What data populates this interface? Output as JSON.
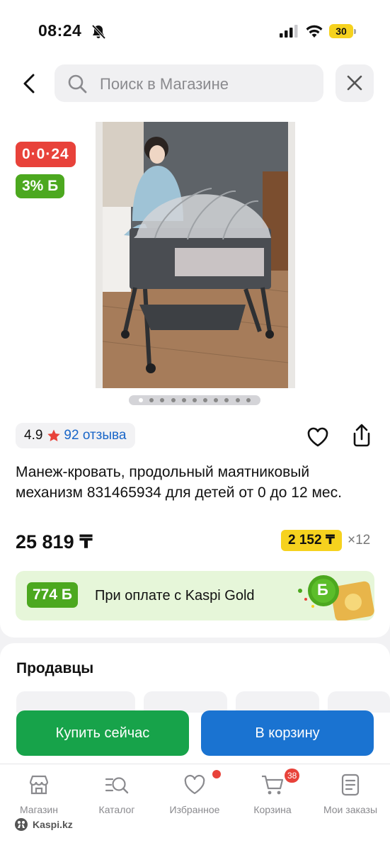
{
  "status_bar": {
    "time": "08:24",
    "battery": "30"
  },
  "search": {
    "placeholder": "Поиск в Магазине"
  },
  "product": {
    "promo_badge": "0·0·24",
    "bonus_badge": "3% Б",
    "image_count": 11,
    "active_image": 1,
    "rating": "4.9",
    "reviews": "92 отзыва",
    "title": "Манеж-кровать, продольный маятниковый механизм 831465934 для детей от 0 до 12 мес.",
    "price": "25 819 ₸",
    "installment_amount": "2 152 ₸",
    "installment_count": "×12",
    "gold_bonus": "774 Б",
    "gold_text": "При оплате с Kaspi Gold"
  },
  "sellers": {
    "title": "Продавцы"
  },
  "actions": {
    "buy_now": "Купить сейчас",
    "add_to_cart": "В корзину"
  },
  "tabbar": {
    "items": [
      {
        "label": "Магазин",
        "icon": "shop-icon"
      },
      {
        "label": "Каталог",
        "icon": "catalog-icon"
      },
      {
        "label": "Избранное",
        "icon": "heart-icon"
      },
      {
        "label": "Корзина",
        "icon": "cart-icon",
        "badge": "38"
      },
      {
        "label": "Мои заказы",
        "icon": "orders-icon"
      }
    ]
  },
  "watermark": "Kaspi.kz",
  "colors": {
    "promo_red": "#e8423a",
    "bonus_green": "#4ca81f",
    "buy_green": "#17a34a",
    "cart_blue": "#1a73d1",
    "installment_yellow": "#f6d21e",
    "link_blue": "#1966c8"
  }
}
